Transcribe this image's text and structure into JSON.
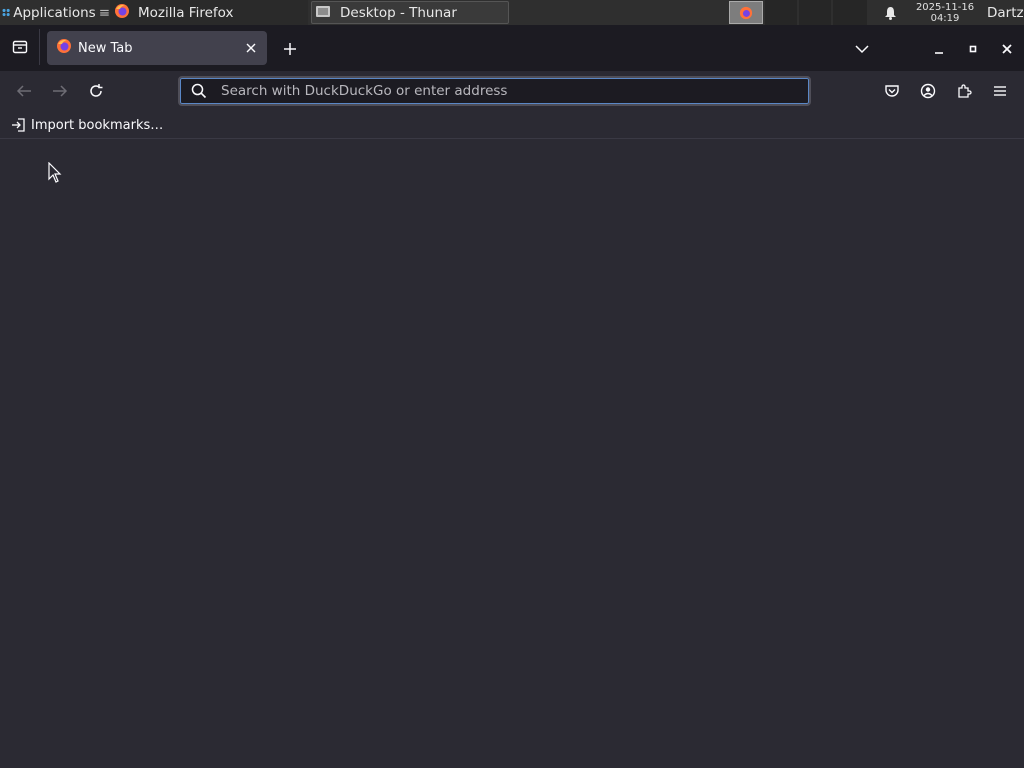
{
  "taskbar": {
    "applications_label": "Applications",
    "windows": [
      {
        "title": "Mozilla Firefox"
      },
      {
        "title": "Desktop - Thunar"
      }
    ],
    "clock_date": "2025-11-16",
    "clock_time": "04:19",
    "user": "Dartz"
  },
  "browser": {
    "tab_title": "New Tab",
    "url_placeholder": "Search with DuckDuckGo or enter address",
    "import_bookmarks_label": "Import bookmarks…"
  },
  "colors": {
    "accent": "#5a87c6",
    "toolbar_bg": "#2b2a33",
    "tabstrip_bg": "#1c1b22"
  }
}
